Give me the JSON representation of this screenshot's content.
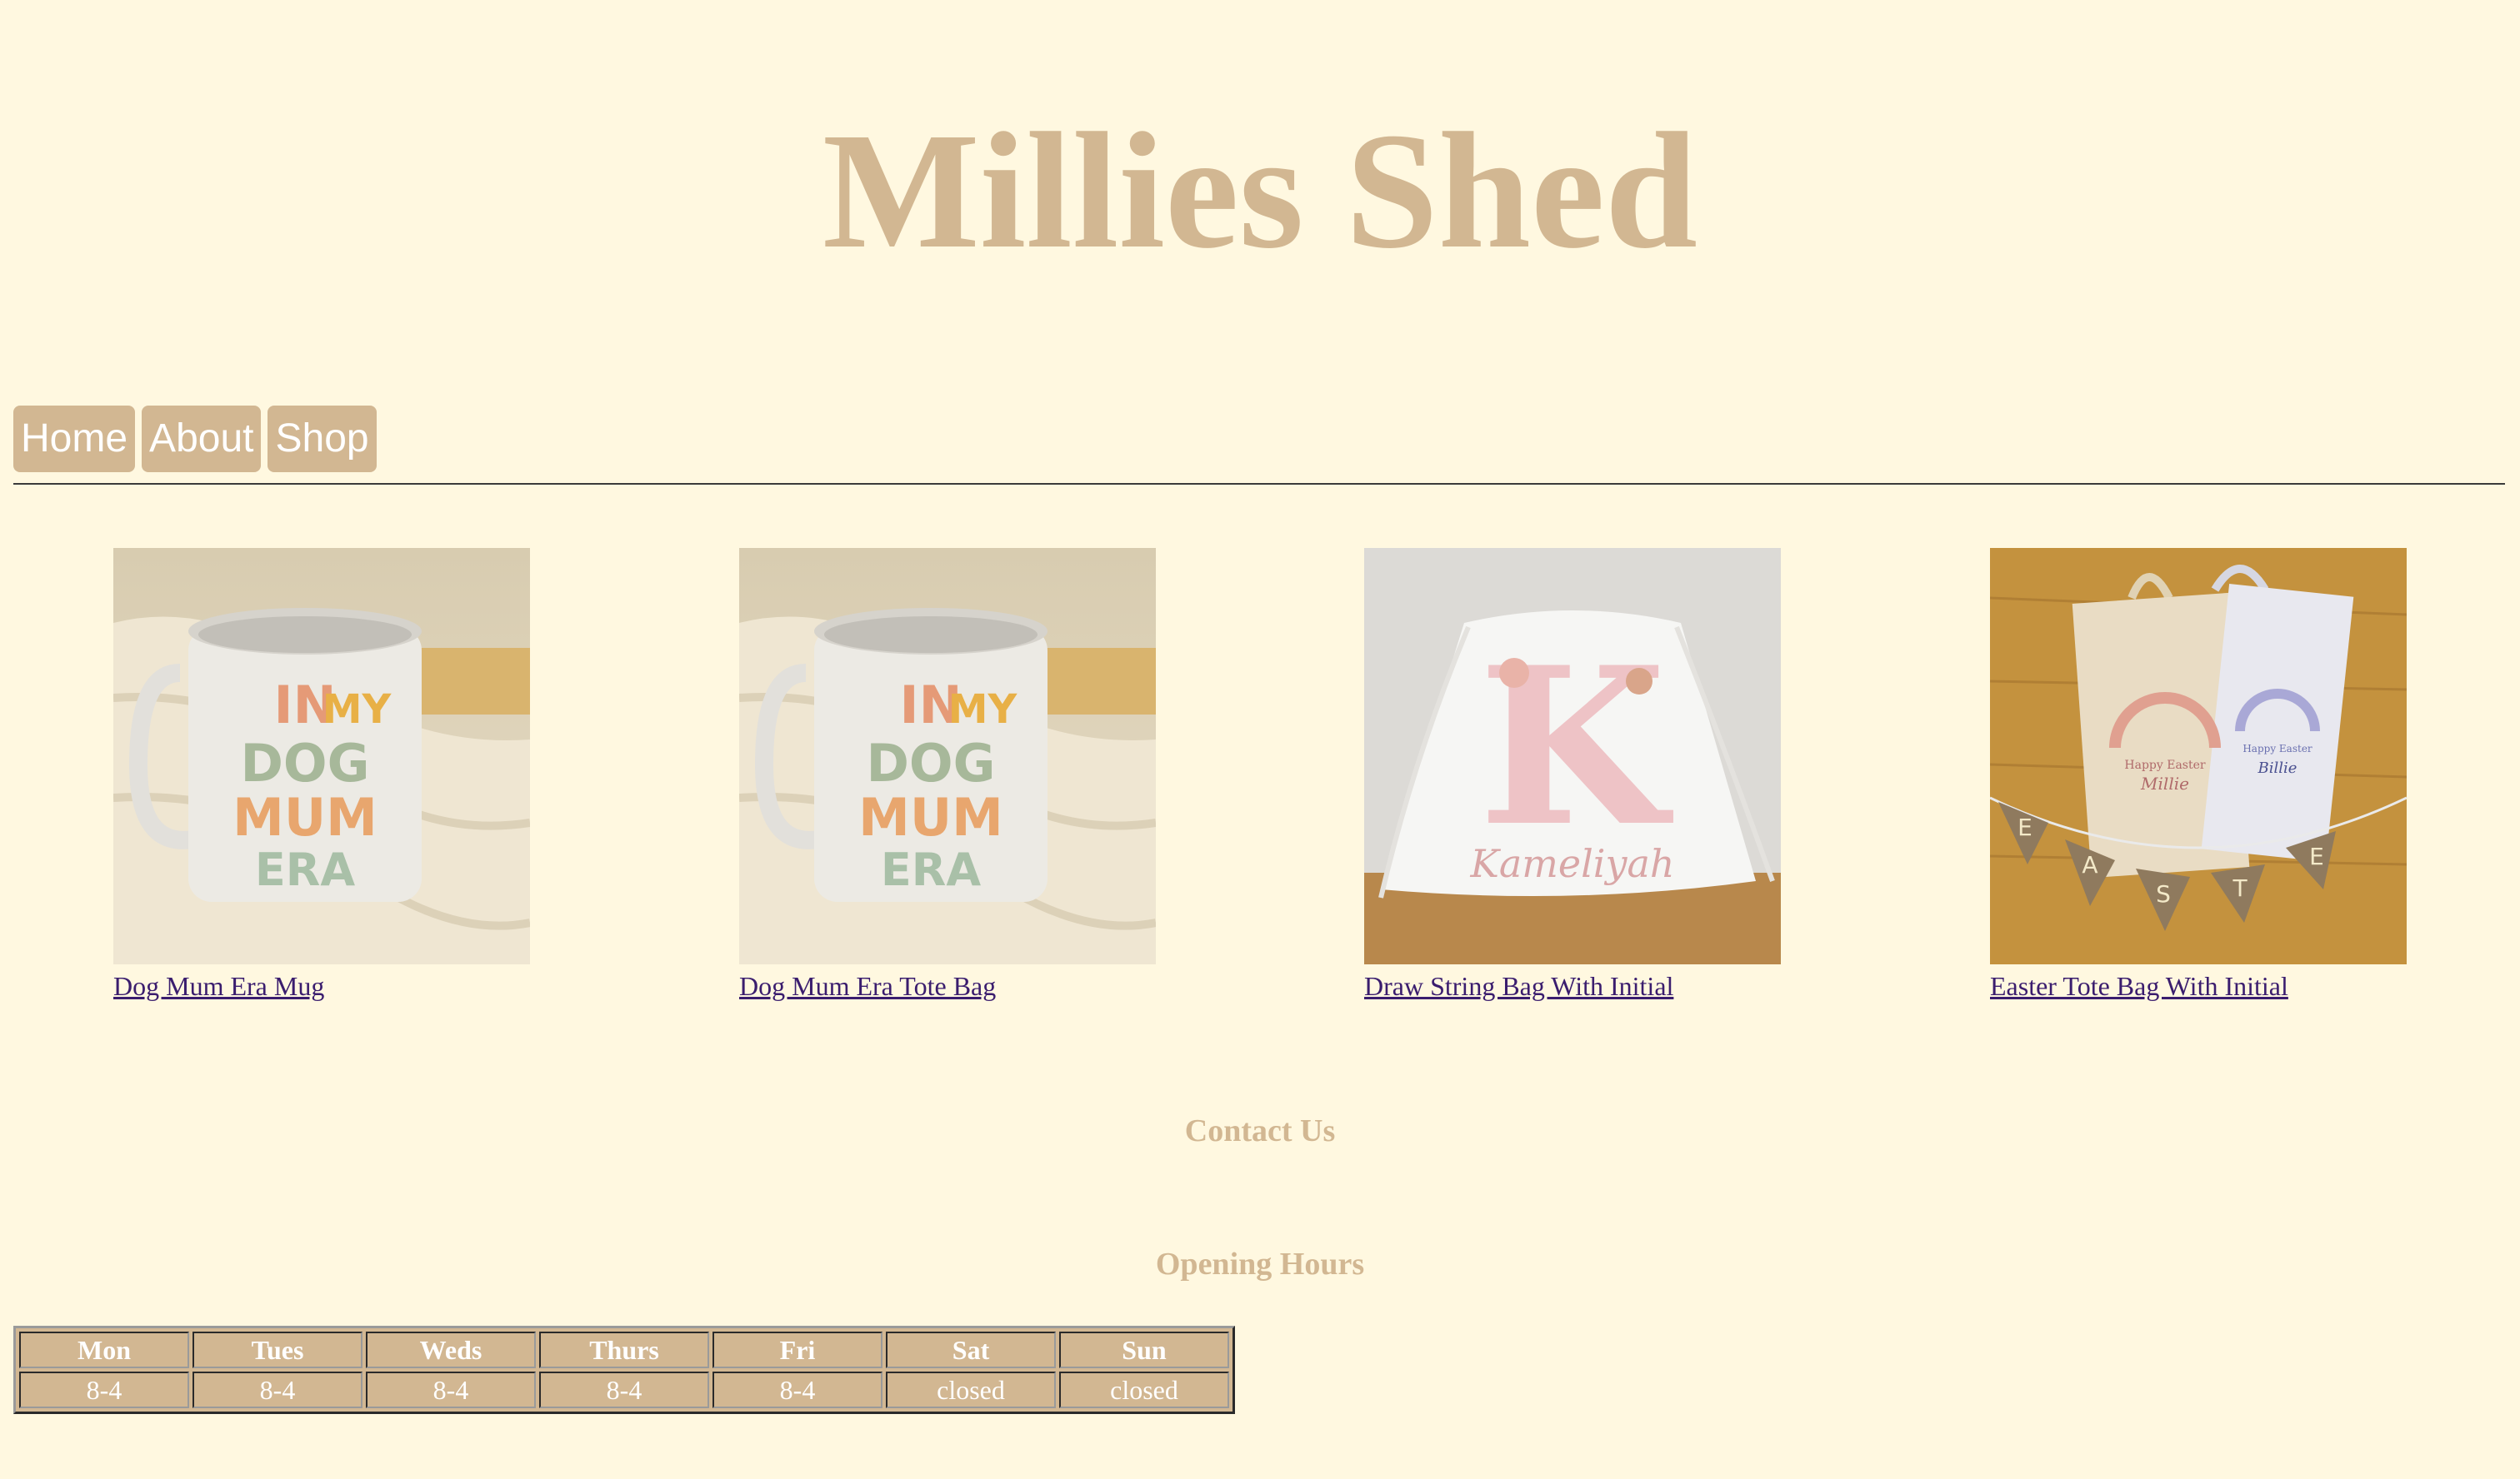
{
  "site": {
    "title": "Millies Shed"
  },
  "nav": [
    {
      "label": "Home"
    },
    {
      "label": "About"
    },
    {
      "label": "Shop"
    }
  ],
  "products": [
    {
      "name": "Dog Mum Era Mug"
    },
    {
      "name": "Dog Mum Era Tote Bag"
    },
    {
      "name": "Draw String Bag With Initial"
    },
    {
      "name": "Easter Tote Bag With Initial"
    }
  ],
  "artwork": {
    "mug_text": [
      "IN",
      "MY",
      "DOG",
      "MUM",
      "ERA"
    ],
    "drawstring_initial": "K",
    "drawstring_name": "Kameliyah",
    "tote_caption": "Happy Easter",
    "tote_names": [
      "Millie",
      "Billie"
    ],
    "bunting_letters": [
      "E",
      "A",
      "S",
      "T",
      "E"
    ]
  },
  "contact": {
    "heading": "Contact Us"
  },
  "hours": {
    "heading": "Opening Hours",
    "days": [
      "Mon",
      "Tues",
      "Weds",
      "Thurs",
      "Fri",
      "Sat",
      "Sun"
    ],
    "times": [
      "8-4",
      "8-4",
      "8-4",
      "8-4",
      "8-4",
      "closed",
      "closed"
    ]
  },
  "colors": {
    "background": "#fff8e0",
    "accent": "#d2b792",
    "link": "#3a1d6e",
    "rule": "#3a3a3a"
  }
}
